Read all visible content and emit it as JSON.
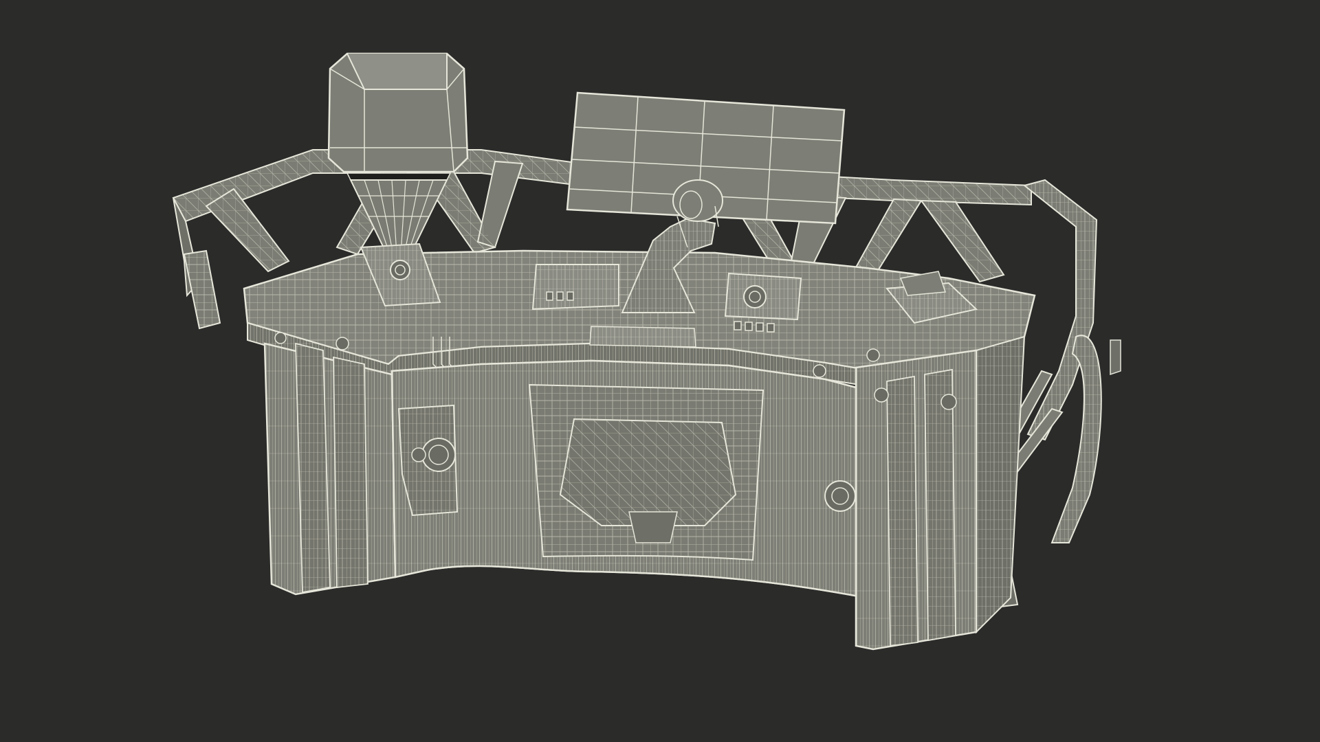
{
  "scene": {
    "background_color": "#2b2b2a",
    "surface_color": "#7b7c73",
    "surface_light_color": "#8f9087",
    "surface_dark_color": "#5f6058",
    "wire_color": "#e6e6da",
    "subject": "wireframe-control-console-3d-model"
  }
}
